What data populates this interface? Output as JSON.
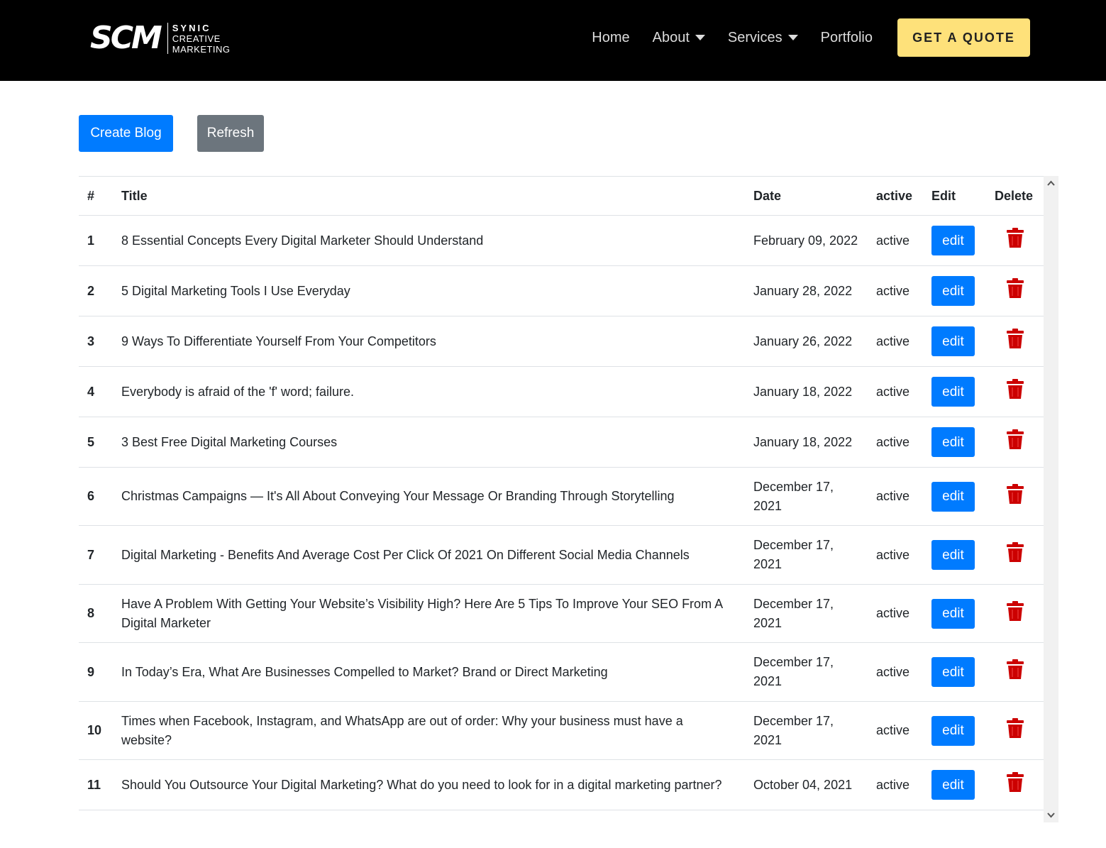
{
  "brand": {
    "mark": "SCM",
    "line1": "SYNIC",
    "line2": "CREATIVE",
    "line3": "MARKETING"
  },
  "nav": {
    "home": "Home",
    "about": "About",
    "services": "Services",
    "portfolio": "Portfolio",
    "quote": "GET A QUOTE"
  },
  "actions": {
    "create": "Create Blog",
    "refresh": "Refresh"
  },
  "table": {
    "headers": {
      "num": "#",
      "title": "Title",
      "date": "Date",
      "active": "active",
      "edit": "Edit",
      "delete": "Delete"
    },
    "rows": [
      {
        "num": "1",
        "title": "8 Essential Concepts Every Digital Marketer Should Understand",
        "date": "February 09, 2022",
        "status": "active",
        "edit": "edit"
      },
      {
        "num": "2",
        "title": "5 Digital Marketing Tools I Use Everyday",
        "date": "January 28, 2022",
        "status": "active",
        "edit": "edit"
      },
      {
        "num": "3",
        "title": "9 Ways To Differentiate Yourself From Your Competitors",
        "date": "January 26, 2022",
        "status": "active",
        "edit": "edit"
      },
      {
        "num": "4",
        "title": "Everybody is afraid of the 'f' word; failure.",
        "date": "January 18, 2022",
        "status": "active",
        "edit": "edit"
      },
      {
        "num": "5",
        "title": "3 Best Free Digital Marketing Courses",
        "date": "January 18, 2022",
        "status": "active",
        "edit": "edit"
      },
      {
        "num": "6",
        "title": "Christmas Campaigns — It's All About Conveying Your Message Or Branding Through Storytelling",
        "date": "December 17, 2021",
        "status": "active",
        "edit": "edit"
      },
      {
        "num": "7",
        "title": "Digital Marketing - Benefits And Average Cost Per Click Of 2021 On Different Social Media Channels",
        "date": "December 17, 2021",
        "status": "active",
        "edit": "edit"
      },
      {
        "num": "8",
        "title": "Have A Problem With Getting Your Website’s Visibility High? Here Are 5 Tips To Improve Your SEO From A Digital Marketer",
        "date": "December 17, 2021",
        "status": "active",
        "edit": "edit"
      },
      {
        "num": "9",
        "title": "In Today’s Era, What Are Businesses Compelled to Market? Brand or Direct Marketing",
        "date": "December 17, 2021",
        "status": "active",
        "edit": "edit"
      },
      {
        "num": "10",
        "title": "Times when Facebook, Instagram, and WhatsApp are out of order: Why your business must have a website?",
        "date": "December 17, 2021",
        "status": "active",
        "edit": "edit"
      },
      {
        "num": "11",
        "title": "Should You Outsource Your Digital Marketing? What do you need to look for in a digital marketing partner?",
        "date": "October 04, 2021",
        "status": "active",
        "edit": "edit"
      }
    ]
  },
  "colors": {
    "header_bg": "#000000",
    "quote_bg": "#fee17a",
    "primary": "#007bff",
    "secondary": "#6c757d",
    "danger": "#cc0000"
  },
  "icons": {
    "delete": "trash-icon",
    "scroll_up": "chevron-up-icon",
    "scroll_down": "chevron-down-icon"
  }
}
